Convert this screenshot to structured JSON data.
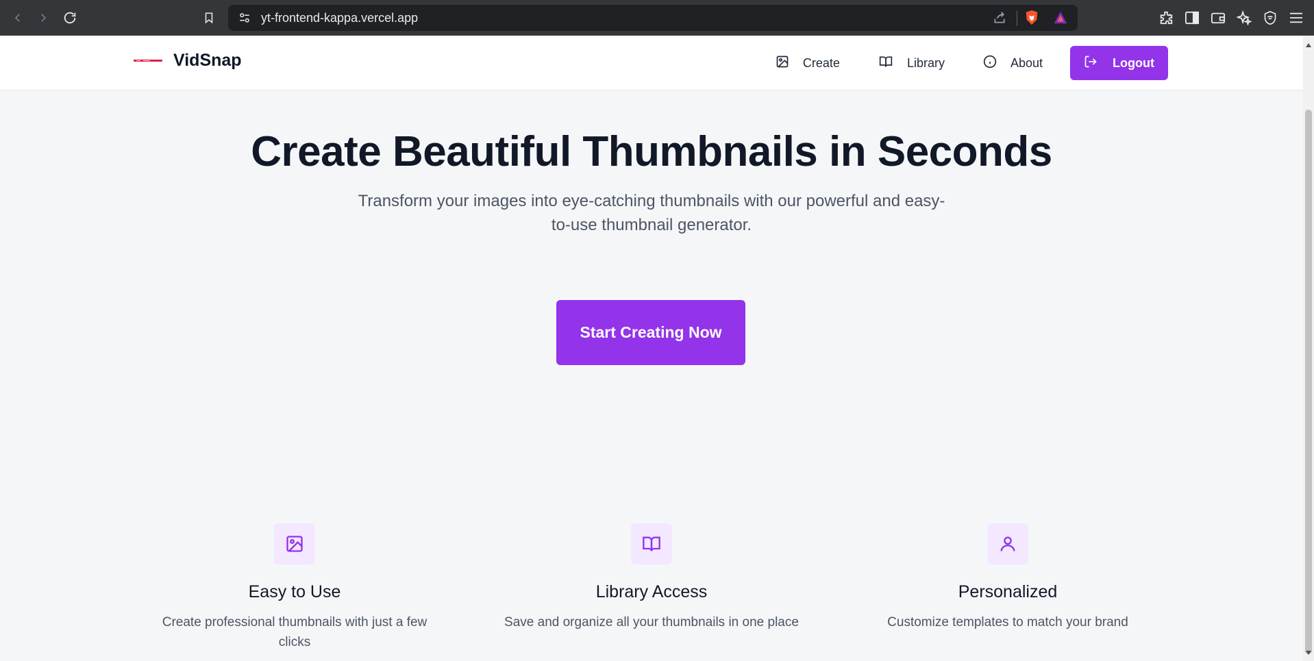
{
  "browser": {
    "url": "yt-frontend-kappa.vercel.app",
    "icons": [
      "back-icon",
      "forward-icon",
      "reload-icon",
      "bookmark-icon",
      "site-settings-icon",
      "share-icon",
      "brave-shield-icon",
      "brave-rewards-icon",
      "extensions-icon",
      "sidebar-icon",
      "wallet-icon",
      "leo-ai-icon",
      "vpn-icon",
      "menu-icon"
    ]
  },
  "navbar": {
    "brand": "VidSnap",
    "links": {
      "create": "Create",
      "library": "Library",
      "about": "About"
    },
    "logout": "Logout",
    "accent": "#9333ea"
  },
  "hero": {
    "title": "Create Beautiful Thumbnails in Seconds",
    "subtitle": "Transform your images into eye-catching thumbnails with our powerful and easy-to-use thumbnail generator.",
    "cta": "Start Creating Now"
  },
  "features": [
    {
      "icon": "image-icon",
      "title": "Easy to Use",
      "desc": "Create professional thumbnails with just a few clicks"
    },
    {
      "icon": "book-open-icon",
      "title": "Library Access",
      "desc": "Save and organize all your thumbnails in one place"
    },
    {
      "icon": "user-icon",
      "title": "Personalized",
      "desc": "Customize templates to match your brand"
    }
  ]
}
